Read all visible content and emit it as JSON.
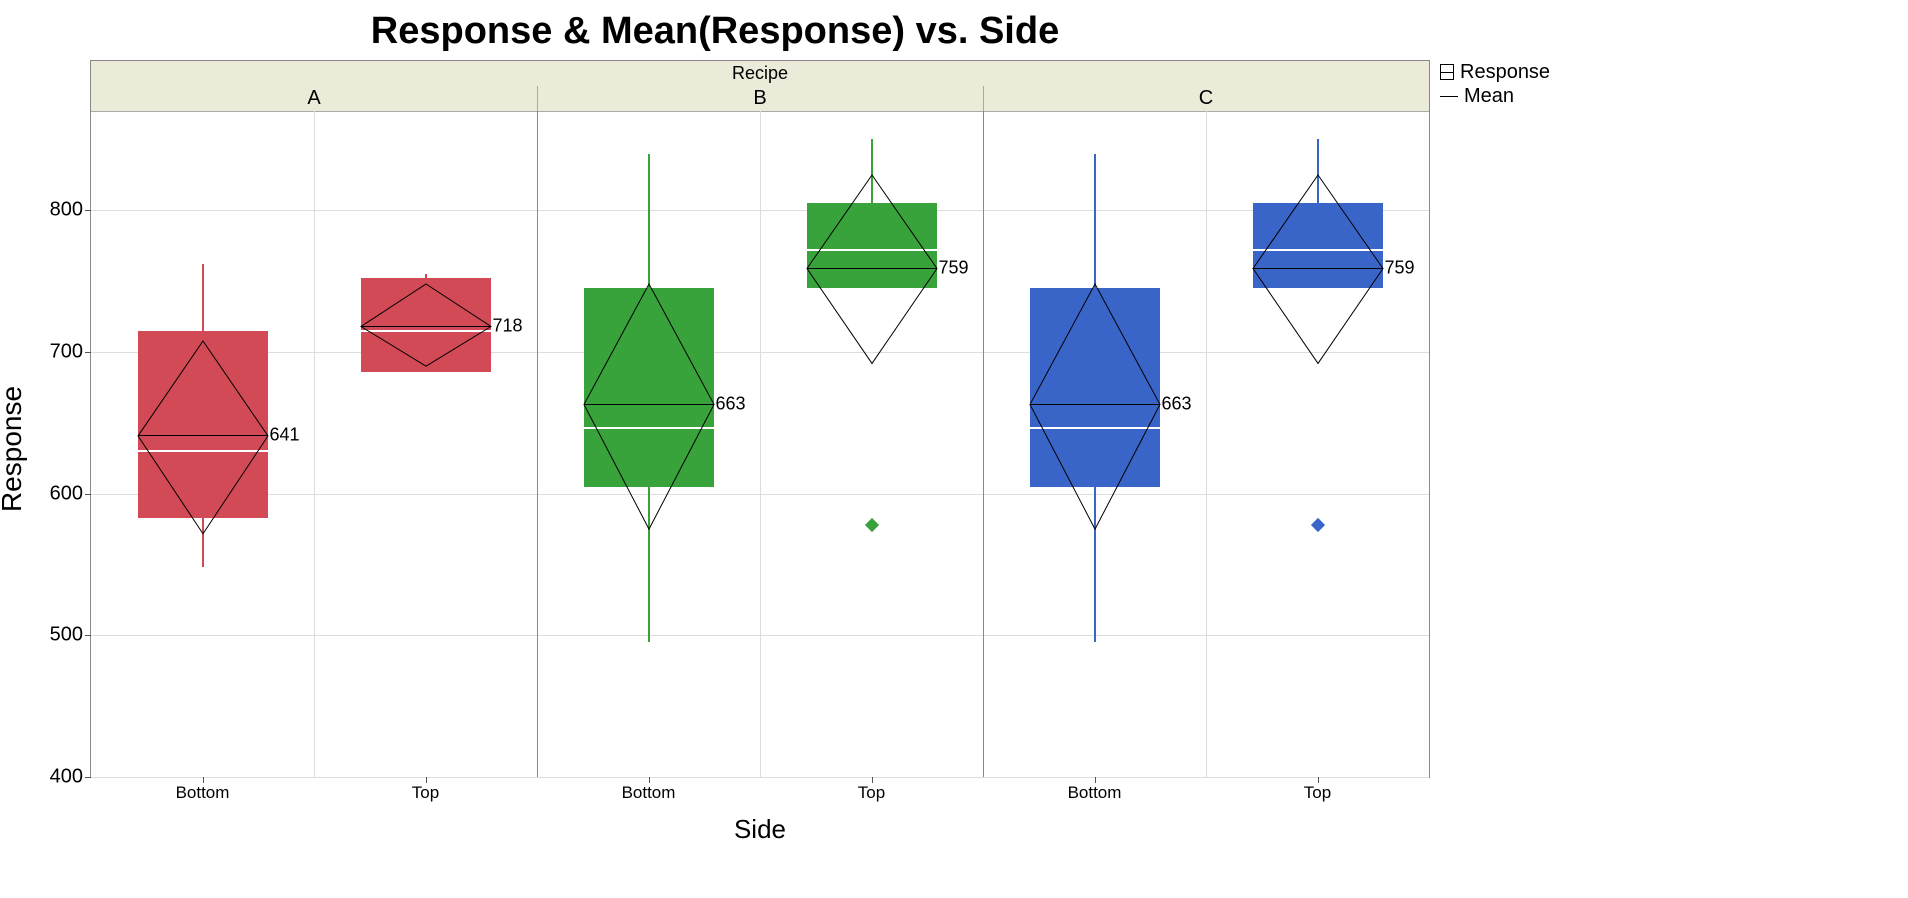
{
  "title": "Response & Mean(Response) vs. Side",
  "ylabel": "Response",
  "xlabel": "Side",
  "facet_var": "Recipe",
  "legend": {
    "response": "Response",
    "mean": "Mean"
  },
  "y_ticks": [
    400,
    500,
    600,
    700,
    800
  ],
  "x_labels": [
    "Bottom",
    "Top"
  ],
  "chart_data": {
    "type": "boxplot",
    "ylim": [
      400,
      870
    ],
    "facet_labels": [
      "A",
      "B",
      "C"
    ],
    "colors": {
      "A": "#d24a55",
      "B": "#39a33b",
      "C": "#3a65c8"
    },
    "series": [
      {
        "facet": "A",
        "side": "Bottom",
        "q1": 583,
        "median": 630,
        "q3": 715,
        "whisker_low": 548,
        "whisker_high": 762,
        "mean": 641,
        "diamond_low": 572,
        "diamond_high": 708,
        "outliers": []
      },
      {
        "facet": "A",
        "side": "Top",
        "q1": 686,
        "median": 715,
        "q3": 752,
        "whisker_low": 686,
        "whisker_high": 755,
        "mean": 718,
        "diamond_low": 690,
        "diamond_high": 748,
        "outliers": []
      },
      {
        "facet": "B",
        "side": "Bottom",
        "q1": 605,
        "median": 646,
        "q3": 745,
        "whisker_low": 495,
        "whisker_high": 840,
        "mean": 663,
        "diamond_low": 575,
        "diamond_high": 748,
        "outliers": []
      },
      {
        "facet": "B",
        "side": "Top",
        "q1": 745,
        "median": 772,
        "q3": 805,
        "whisker_low": 745,
        "whisker_high": 850,
        "mean": 759,
        "diamond_low": 692,
        "diamond_high": 825,
        "outliers": [
          578
        ]
      },
      {
        "facet": "C",
        "side": "Bottom",
        "q1": 605,
        "median": 646,
        "q3": 745,
        "whisker_low": 495,
        "whisker_high": 840,
        "mean": 663,
        "diamond_low": 575,
        "diamond_high": 748,
        "outliers": []
      },
      {
        "facet": "C",
        "side": "Top",
        "q1": 745,
        "median": 772,
        "q3": 805,
        "whisker_low": 745,
        "whisker_high": 850,
        "mean": 759,
        "diamond_low": 692,
        "diamond_high": 825,
        "outliers": [
          578
        ]
      }
    ]
  }
}
